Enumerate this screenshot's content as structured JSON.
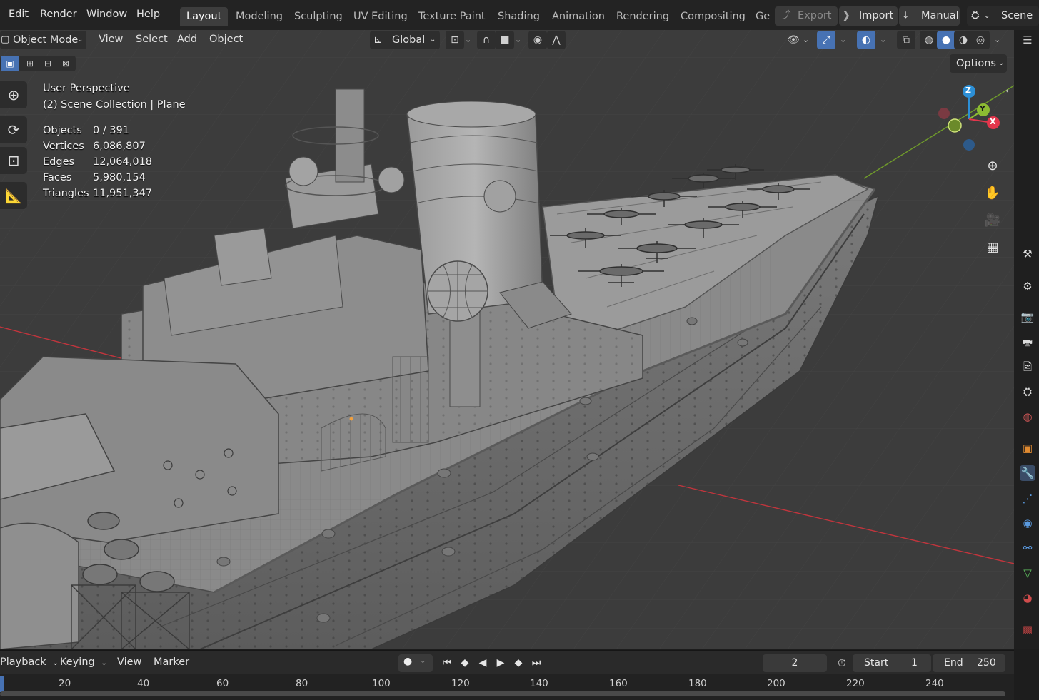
{
  "menu": {
    "edit": "Edit",
    "render": "Render",
    "window": "Window",
    "help": "Help"
  },
  "workspaces": [
    "Layout",
    "Modeling",
    "Sculpting",
    "UV Editing",
    "Texture Paint",
    "Shading",
    "Animation",
    "Rendering",
    "Compositing",
    "Ge"
  ],
  "topright": {
    "export": "Export",
    "import": "Import",
    "manual": "Manual",
    "scene": "Scene"
  },
  "header": {
    "mode": "Object Mode",
    "view": "View",
    "select": "Select",
    "add": "Add",
    "object": "Object",
    "orientation": "Global",
    "options": "Options"
  },
  "overlay": {
    "perspective": "User Perspective",
    "collection": "(2) Scene Collection | Plane",
    "stats": [
      {
        "label": "Objects",
        "value": "0 / 391"
      },
      {
        "label": "Vertices",
        "value": "6,086,807"
      },
      {
        "label": "Edges",
        "value": "12,064,018"
      },
      {
        "label": "Faces",
        "value": "5,980,154"
      },
      {
        "label": "Triangles",
        "value": "11,951,347"
      }
    ]
  },
  "gizmo": {
    "z": "Z",
    "y": "Y",
    "x": "X"
  },
  "timeline": {
    "playback": "Playback",
    "keying": "Keying",
    "view": "View",
    "marker": "Marker",
    "current_frame": "2",
    "start_label": "Start",
    "start": "1",
    "end_label": "End",
    "end": "250",
    "ruler": [
      "20",
      "40",
      "60",
      "80",
      "100",
      "120",
      "140",
      "160",
      "180",
      "200",
      "220",
      "240"
    ]
  },
  "colors": {
    "accent": "#4772b3",
    "x_axis": "#e3364c",
    "y_axis": "#8cbb32",
    "z_axis": "#2c8fd6"
  }
}
